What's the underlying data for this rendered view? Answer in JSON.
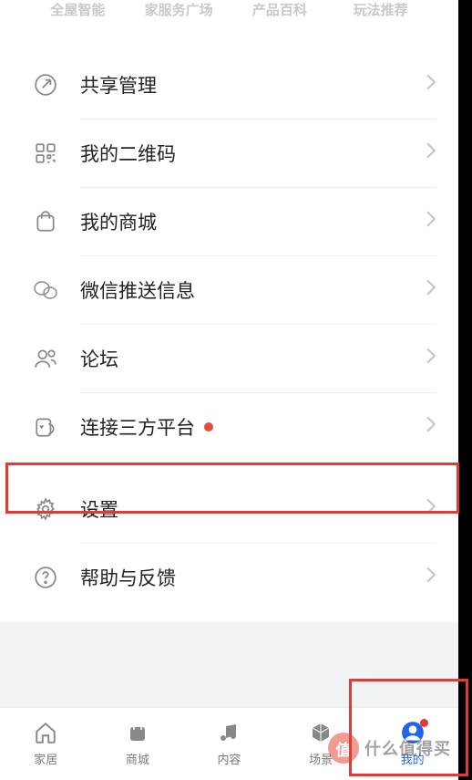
{
  "top_tabs": [
    "全屋智能",
    "家服务广场",
    "产品百科",
    "玩法推荐"
  ],
  "menu": [
    {
      "label": "共享管理",
      "icon": "share-arrow-icon",
      "dot": false
    },
    {
      "label": "我的二维码",
      "icon": "qrcode-icon",
      "dot": false
    },
    {
      "label": "我的商城",
      "icon": "bag-icon",
      "dot": false
    },
    {
      "label": "微信推送信息",
      "icon": "wechat-icon",
      "dot": false
    },
    {
      "label": "论坛",
      "icon": "people-icon",
      "dot": false
    },
    {
      "label": "连接三方平台",
      "icon": "shield-heart-icon",
      "dot": true
    },
    {
      "label": "设置",
      "icon": "gear-icon",
      "dot": false
    },
    {
      "label": "帮助与反馈",
      "icon": "help-icon",
      "dot": false
    }
  ],
  "bottom_nav": [
    {
      "label": "家居",
      "icon": "home-icon",
      "dot": false,
      "active": false
    },
    {
      "label": "商城",
      "icon": "bag-icon",
      "dot": false,
      "active": false
    },
    {
      "label": "内容",
      "icon": "music-icon",
      "dot": false,
      "active": false
    },
    {
      "label": "场景",
      "icon": "cube-icon",
      "dot": false,
      "active": false
    },
    {
      "label": "我的",
      "icon": "avatar-icon",
      "dot": true,
      "active": true
    }
  ],
  "watermark": {
    "badge": "值",
    "text": "什么值得买"
  },
  "colors": {
    "highlight": "#e53935",
    "accent": "#2563eb"
  }
}
